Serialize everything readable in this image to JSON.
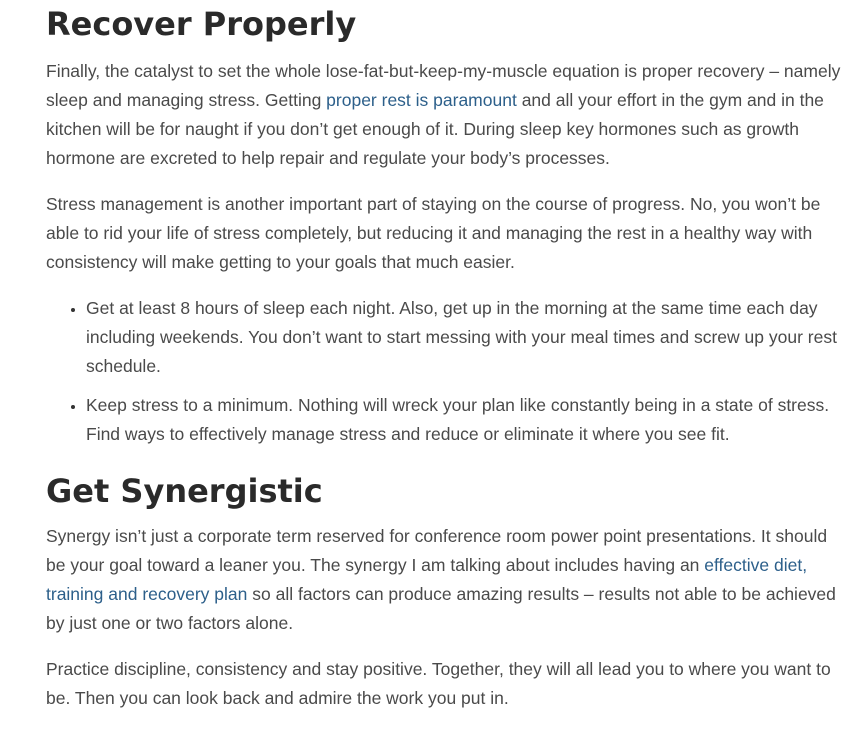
{
  "section1": {
    "heading": "Recover Properly",
    "p1": {
      "before": "Finally, the catalyst to set the whole lose-fat-but-keep-my-muscle equation is proper recovery – namely sleep and managing stress. Getting ",
      "link": "proper rest is paramount",
      "after": " and all your effort in the gym and in the kitchen will be for naught if you don’t get enough of it. During sleep key hormones such as growth hormone are excreted to help repair and regulate your body’s processes."
    },
    "p2": "Stress management is another important part of staying on the course of progress. No, you won’t be able to rid your life of stress completely, but reducing it and managing the rest in a healthy way with consistency will make getting to your goals that much easier.",
    "bullets": [
      "Get at least 8 hours of sleep each night. Also, get up in the morning at the same time each day including weekends. You don’t want to start messing with your meal times and screw up your rest schedule.",
      "Keep stress to a minimum. Nothing will wreck your plan like constantly being in a state of stress. Find ways to effectively manage stress and reduce or eliminate it where you see fit."
    ]
  },
  "section2": {
    "heading": "Get Synergistic",
    "p1": {
      "before": "Synergy isn’t just a corporate term reserved for conference room power point presentations. It should be your goal toward a leaner you. The synergy I am talking about includes having an ",
      "link": "effective diet, training and recovery plan",
      "after": " so all factors can produce amazing results – results not able to be achieved by just one or two factors alone."
    },
    "p2": "Practice discipline, consistency and stay positive. Together, they will all lead you to where you want to be. Then you can look back and admire the work you put in."
  },
  "colors": {
    "text": "#4a4a4a",
    "heading": "#2a2a2a",
    "link": "#2c5f8a",
    "background": "#ffffff"
  }
}
